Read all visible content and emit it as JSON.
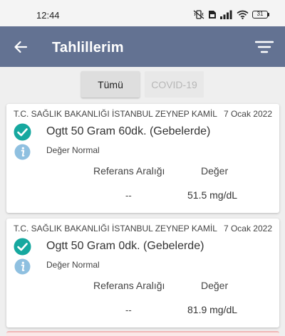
{
  "status_bar": {
    "time": "12:44",
    "battery": "31"
  },
  "app_bar": {
    "title": "Tahlillerim",
    "back_icon": "arrow-left-icon",
    "filter_icon": "filter-icon"
  },
  "filters": {
    "all_label": "Tümü",
    "covid_label": "COVID-19",
    "selected": "Tümü"
  },
  "results": [
    {
      "hospital": "T.C. SAĞLIK BAKANLIĞI İSTANBUL ZEYNEP KAMİL",
      "date": "7 Ocak 2022",
      "test_name": "Ogtt 50 Gram 60dk. (Gebelerde)",
      "status": "Değer Normal",
      "reference_header": "Referans Aralığı",
      "value_header": "Değer",
      "reference_value": "--",
      "value": "51.5 mg/dL"
    },
    {
      "hospital": "T.C. SAĞLIK BAKANLIĞI İSTANBUL ZEYNEP KAMİL",
      "date": "7 Ocak 2022",
      "test_name": "Ogtt 50 Gram 0dk. (Gebelerde)",
      "status": "Değer Normal",
      "reference_header": "Referans Aralığı",
      "value_header": "Değer",
      "reference_value": "--",
      "value": "81.9 mg/dL"
    }
  ],
  "colors": {
    "app_bar": "#637292",
    "check": "#16a89f",
    "info": "#8fc0e0",
    "background": "#efefef"
  }
}
